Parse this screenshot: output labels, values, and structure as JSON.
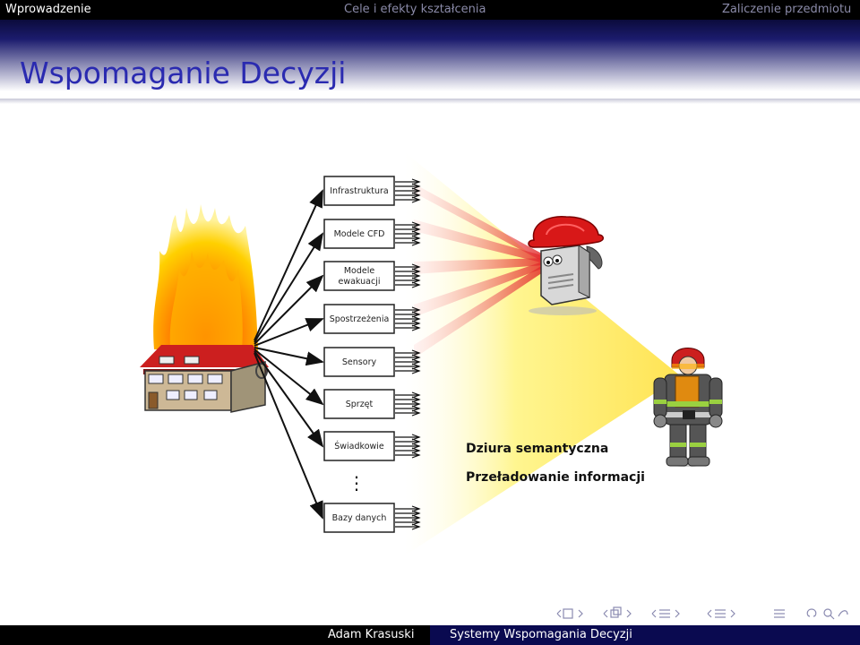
{
  "nav": {
    "section1": "Wprowadzenie",
    "section2": "Cele i efekty kształcenia",
    "section3": "Zaliczenie przedmiotu"
  },
  "slide": {
    "title": "Wspomaganie Decyzji"
  },
  "diagram": {
    "boxes": [
      {
        "label": "Infrastruktura"
      },
      {
        "label": "Modele CFD"
      },
      {
        "label_lines": [
          "Modele",
          "ewakuacji"
        ]
      },
      {
        "label": "Spostrzeżenia"
      },
      {
        "label": "Sensory"
      },
      {
        "label": "Sprzęt"
      },
      {
        "label": "Świadkowie"
      },
      {
        "label": "Bazy danych"
      }
    ],
    "ellipsis": "⋮",
    "problem1": "Dziura semantyczna",
    "problem2": "Przeładowanie informacji",
    "icons": [
      "burning-house-icon",
      "fire-server-robot-icon",
      "firefighter-icon"
    ],
    "colors": {
      "fire": "#ff4400",
      "beam_yellow": "#fff27a",
      "beam_red": "#e83030",
      "box_border": "#222222"
    }
  },
  "footer": {
    "author": "Adam Krasuski",
    "presentation_title": "Systemy Wspomagania Decyzji"
  }
}
